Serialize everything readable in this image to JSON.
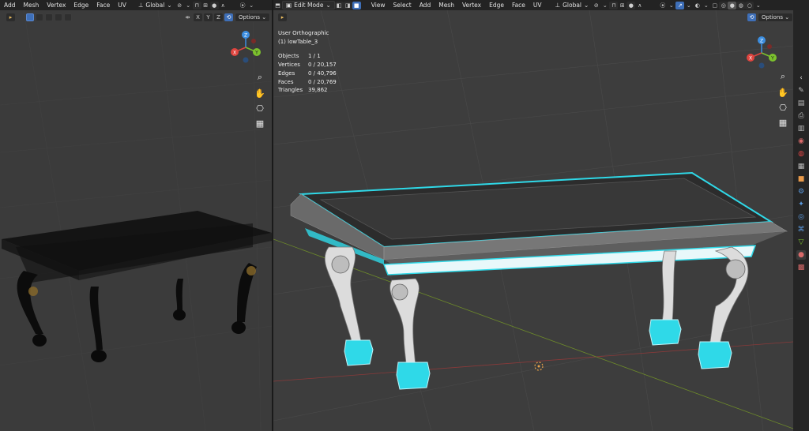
{
  "left_header": {
    "menus": [
      "Add",
      "Mesh",
      "Vertex",
      "Edge",
      "Face",
      "UV"
    ],
    "orientation": "Global"
  },
  "right_header": {
    "mode": "Edit Mode",
    "menus": [
      "View",
      "Select",
      "Add",
      "Mesh",
      "Vertex",
      "Edge",
      "Face",
      "UV"
    ],
    "orientation": "Global"
  },
  "left_toolrow": {
    "options_label": "Options"
  },
  "right_toolrow": {
    "options_label": "Options"
  },
  "overlay": {
    "view_name": "User Orthographic",
    "object_name": "(1) lowTable_3",
    "stats": [
      {
        "label": "Objects",
        "value": "1 / 1"
      },
      {
        "label": "Vertices",
        "value": "0 / 20,157"
      },
      {
        "label": "Edges",
        "value": "0 / 40,796"
      },
      {
        "label": "Faces",
        "value": "0 / 20,769"
      },
      {
        "label": "Triangles",
        "value": "39,862"
      }
    ]
  },
  "gizmo": {
    "z": "Z",
    "x": "X",
    "y": "Y"
  },
  "colors": {
    "selection": "#2fd9e8",
    "axis_x": "#e0453f",
    "axis_y": "#7cc22d",
    "axis_z": "#3c8ee0",
    "active_button": "#3e6fb8"
  },
  "icons": {
    "zoom": "magnifier-icon",
    "pan": "hand-icon",
    "camera": "camera-icon",
    "grid": "grid-icon"
  }
}
